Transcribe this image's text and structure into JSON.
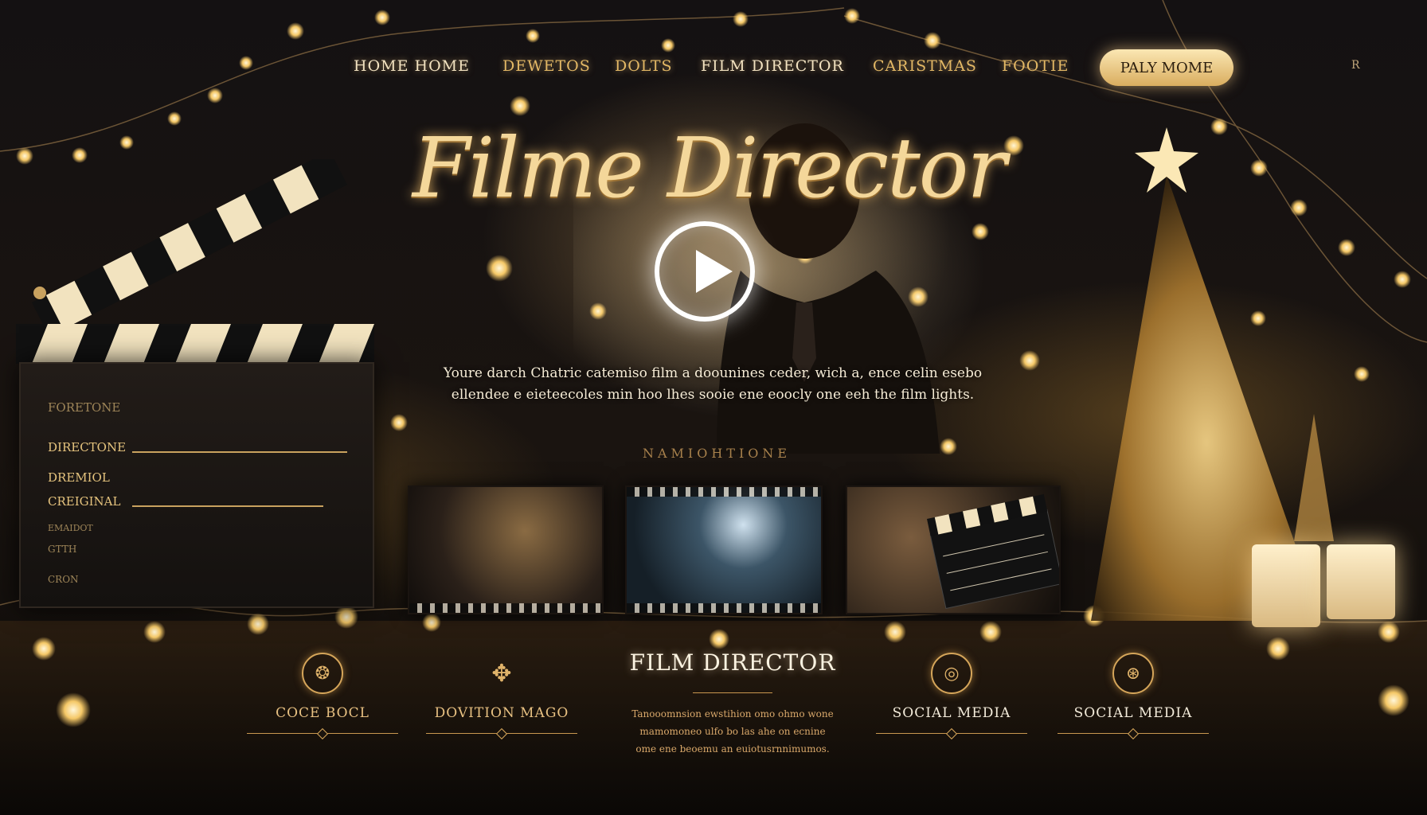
{
  "nav": {
    "items": [
      "HOME HOME",
      "DEWETOS",
      "DOLTS",
      "FILM  DIRECTOR",
      "CARISTMAS",
      "FOOTIE"
    ],
    "cta_label": "PALY MOME",
    "mark": "R"
  },
  "hero": {
    "title": "Filme Director",
    "play_icon": "play-icon",
    "description_line1": "Youre darch Chatric catemiso film a doounines ceder, wich a, ence celin esebo",
    "description_line2": "ellendee e eieteecoles min hoo lhes sooie ene eoocly one eeh the film lights.",
    "gallery_label": "NAMIOHTIONE"
  },
  "clapperboard": {
    "rows": [
      "FORETONE",
      "DIRECTONE",
      "DREMIOL",
      "CREIGINAL",
      "EMAIDOT",
      "GTTH",
      "CRON"
    ]
  },
  "footer": {
    "col1_label": "COCE BOCL",
    "col2_label": "DOVITION MAGO",
    "center_title": "FILM DIRECTOR",
    "center_desc_line1": "Tanooomnsion ewstihion omo ohmo wone",
    "center_desc_line2": "mamomoneo ulfo bo las ahe on ecnine",
    "center_desc_line3": "ome ene beoemu an euiotusrnnimumos.",
    "col3_label": "SOCIAL MEDIA",
    "col4_label": "SOCIAL MEDIA",
    "icons": [
      "emblem-icon",
      "crest-icon",
      "social-icon",
      "social-icon"
    ]
  },
  "colors": {
    "gold": "#e3b865",
    "background": "#0d0b0a",
    "cream": "#f6ecd6"
  }
}
